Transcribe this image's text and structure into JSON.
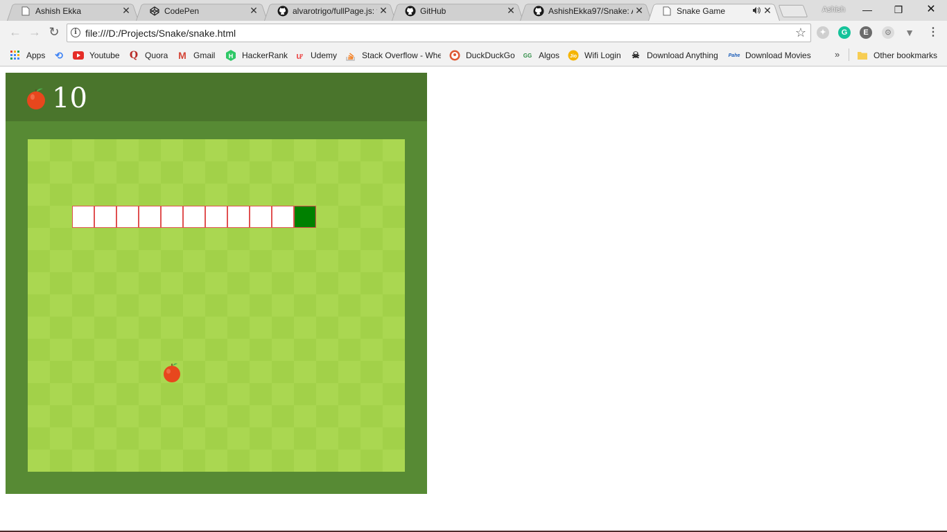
{
  "tabs": [
    {
      "title": "Ashish Ekka",
      "icon": "page-icon",
      "active": false
    },
    {
      "title": "CodePen",
      "icon": "codepen-icon",
      "active": false
    },
    {
      "title": "alvarotrigo/fullPage.js: f",
      "icon": "github-icon",
      "active": false
    },
    {
      "title": "GitHub",
      "icon": "github-icon",
      "active": false
    },
    {
      "title": "AshishEkka97/Snake: A",
      "icon": "github-icon",
      "active": false
    },
    {
      "title": "Snake Game",
      "icon": "page-icon",
      "active": true,
      "audio": true
    }
  ],
  "profile_name": "Ashish",
  "omnibox": {
    "url": "file:///D:/Projects/Snake/snake.html"
  },
  "bookmarks": [
    {
      "label": "Apps",
      "icon": "apps-grid-icon"
    },
    {
      "label": "",
      "icon": "history-icon"
    },
    {
      "label": "Youtube",
      "icon": "youtube-icon"
    },
    {
      "label": "Quora",
      "icon": "quora-icon"
    },
    {
      "label": "Gmail",
      "icon": "gmail-icon"
    },
    {
      "label": "HackerRank",
      "icon": "hackerrank-icon"
    },
    {
      "label": "Udemy",
      "icon": "udemy-icon"
    },
    {
      "label": "Stack Overflow - Whe",
      "icon": "stackoverflow-icon"
    },
    {
      "label": "DuckDuckGo",
      "icon": "duckduckgo-icon"
    },
    {
      "label": "Algos",
      "icon": "algos-icon"
    },
    {
      "label": "Wifi Login",
      "icon": "jio-icon"
    },
    {
      "label": "Download Anything",
      "icon": "pirate-icon"
    },
    {
      "label": "Download Movies",
      "icon": "pahe-icon"
    }
  ],
  "other_bookmarks": "Other bookmarks",
  "game": {
    "score": "10",
    "board_cols": 17,
    "board_rows": 15,
    "colors": {
      "header": "#4a752c",
      "border": "#578a34",
      "cell_light": "#aad751",
      "cell_dark": "#a2d149",
      "snake_body": "#ffffff",
      "snake_head": "#008000",
      "snake_outline": "#e05050"
    },
    "snake_cells": [
      [
        2,
        3
      ],
      [
        3,
        3
      ],
      [
        4,
        3
      ],
      [
        5,
        3
      ],
      [
        6,
        3
      ],
      [
        7,
        3
      ],
      [
        8,
        3
      ],
      [
        9,
        3
      ],
      [
        10,
        3
      ],
      [
        11,
        3
      ],
      [
        12,
        3
      ]
    ],
    "head_cell": [
      12,
      3
    ],
    "food_cell": [
      6,
      10
    ]
  }
}
